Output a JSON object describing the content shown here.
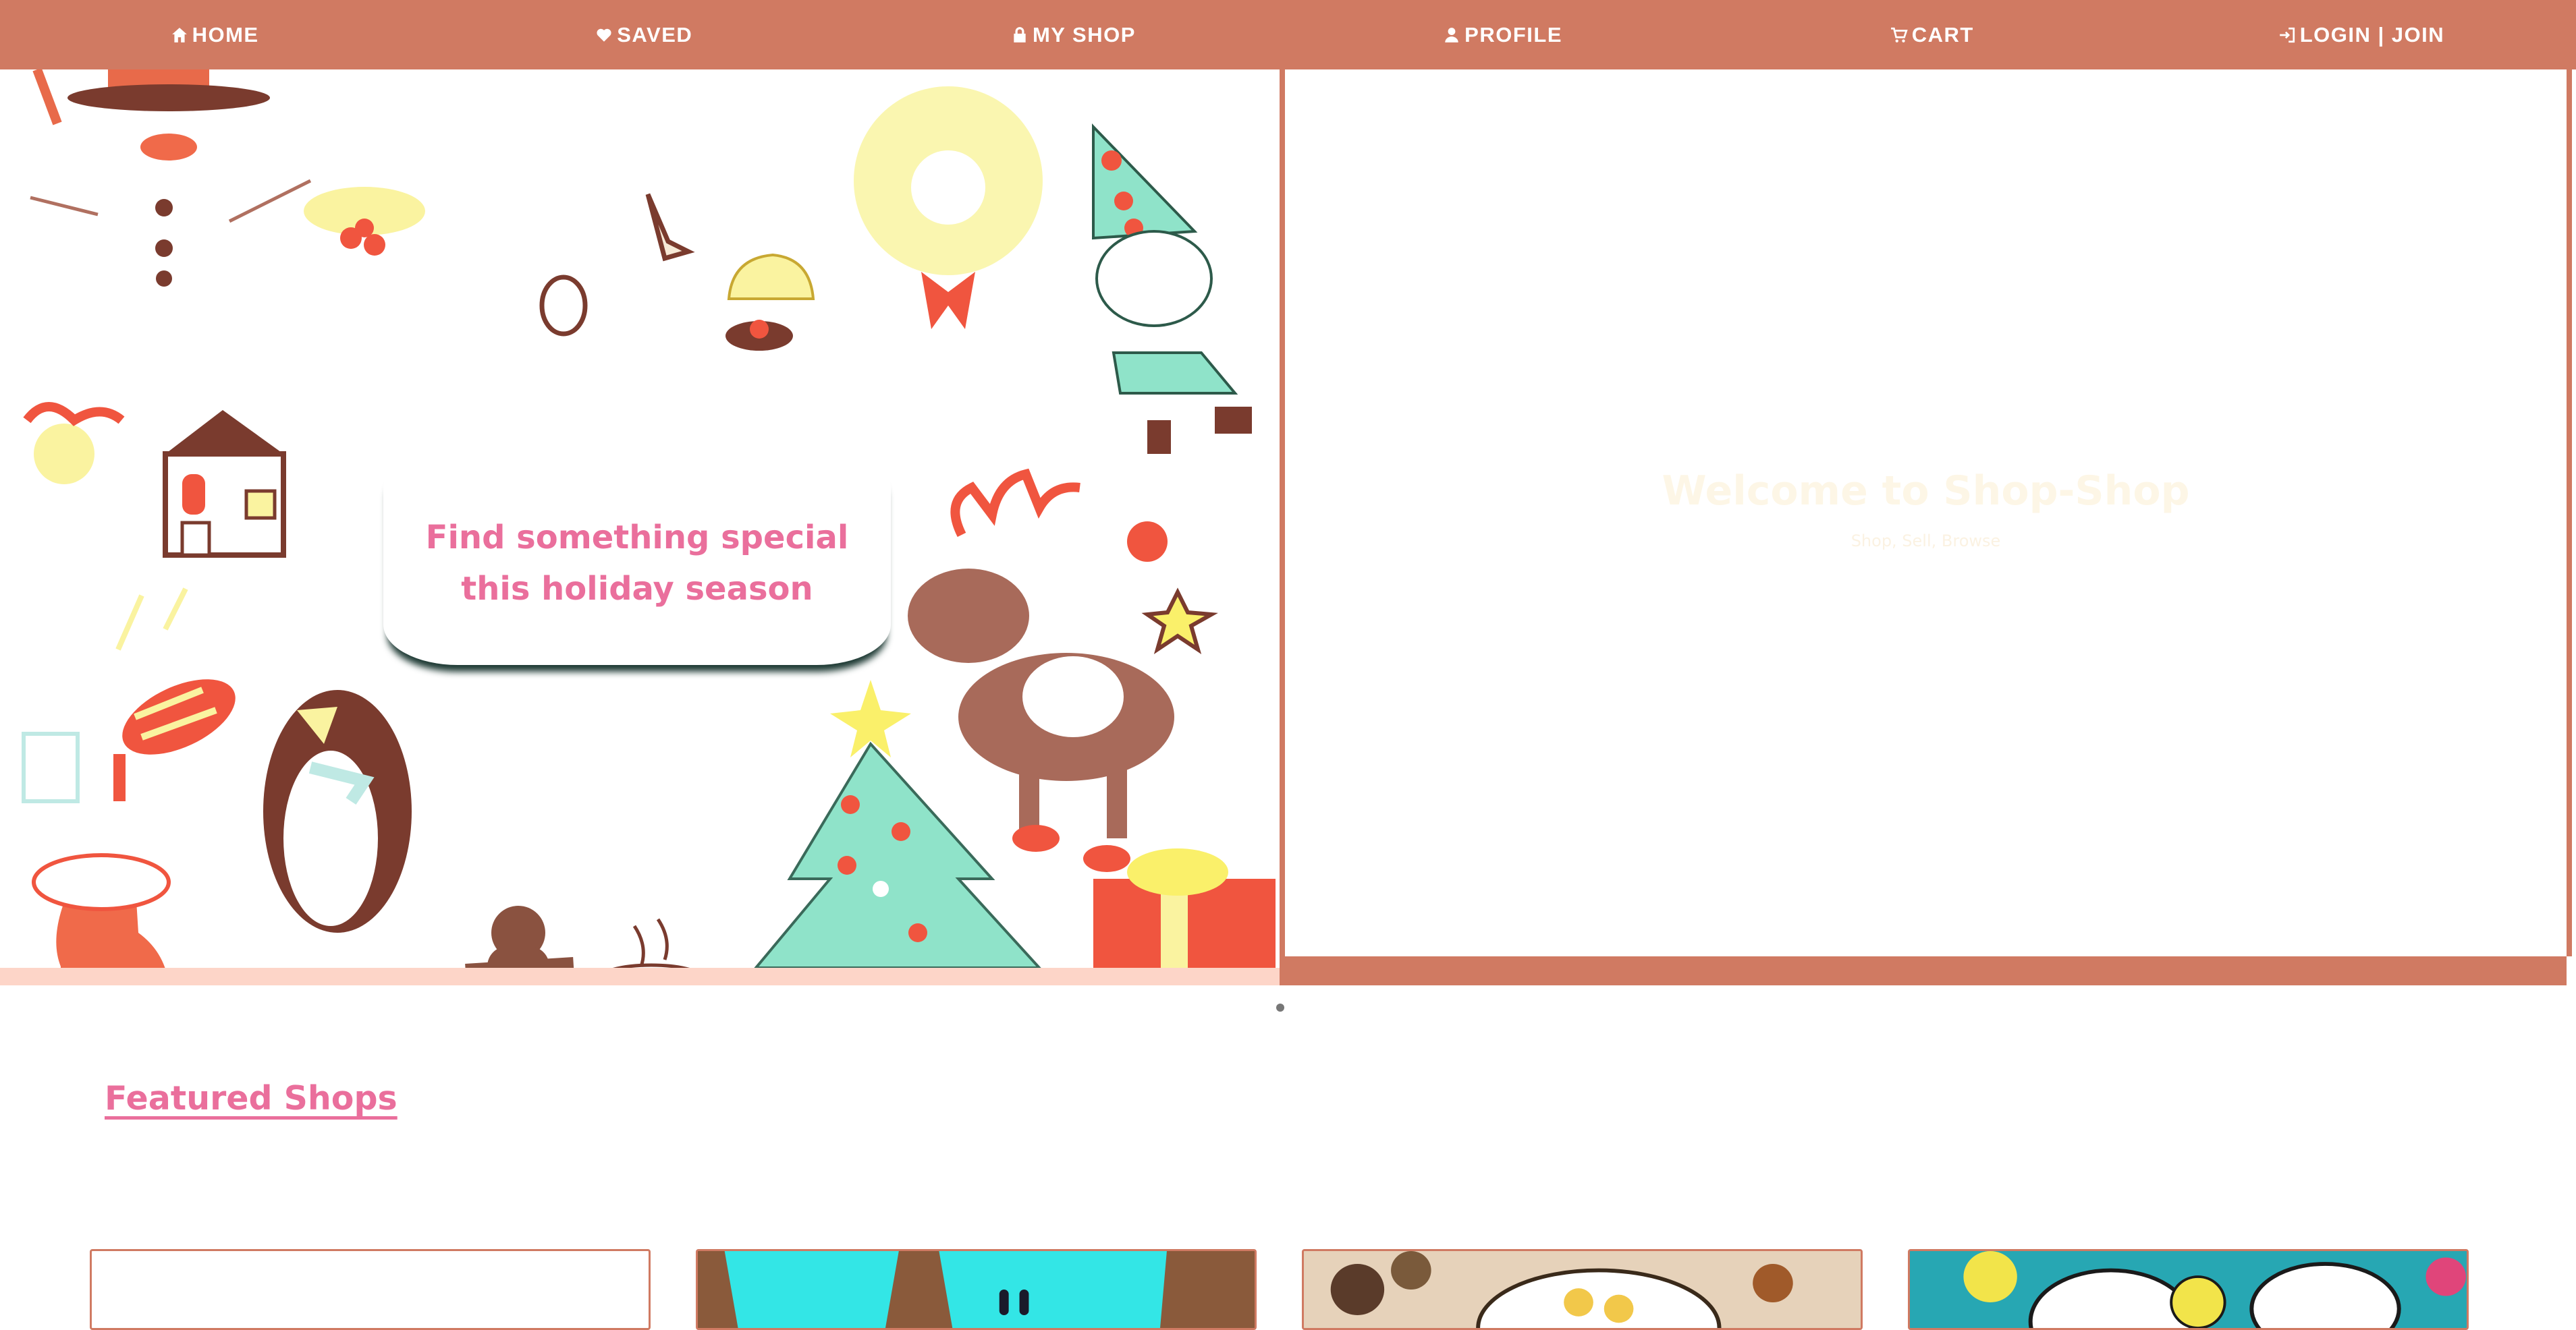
{
  "nav": {
    "items": [
      {
        "label": "HOME",
        "icon": "home-icon"
      },
      {
        "label": "SAVED",
        "icon": "heart-icon"
      },
      {
        "label": "MY SHOP",
        "icon": "lock-icon"
      },
      {
        "label": "PROFILE",
        "icon": "person-icon"
      },
      {
        "label": "CART",
        "icon": "cart-icon"
      },
      {
        "label": "LOGIN | JOIN",
        "icon": "login-icon"
      }
    ],
    "background": "#d07a62"
  },
  "hero": {
    "banner_text": "Find something special this holiday season",
    "welcome_title": "Welcome to Shop-Shop",
    "welcome_subtitle": "Shop, Sell, Browse"
  },
  "featured": {
    "heading": "Featured Shops"
  },
  "colors": {
    "accent": "#d07a62",
    "heading_pink": "#ea6f9c",
    "peach": "#fdd5c8"
  }
}
